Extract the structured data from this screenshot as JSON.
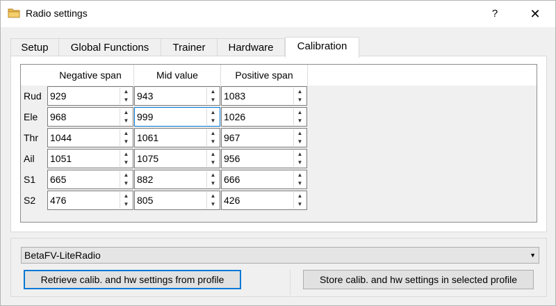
{
  "window": {
    "title": "Radio settings",
    "help_label": "?",
    "close_label": "✕"
  },
  "tabs": [
    {
      "label": "Setup",
      "active": false
    },
    {
      "label": "Global Functions",
      "active": false
    },
    {
      "label": "Trainer",
      "active": false
    },
    {
      "label": "Hardware",
      "active": false
    },
    {
      "label": "Calibration",
      "active": true
    }
  ],
  "calibration": {
    "columns": [
      "Negative span",
      "Mid value",
      "Positive span"
    ],
    "rows": [
      {
        "label": "Rud",
        "values": [
          "929",
          "943",
          "1083"
        ]
      },
      {
        "label": "Ele",
        "values": [
          "968",
          "999",
          "1026"
        ]
      },
      {
        "label": "Thr",
        "values": [
          "1044",
          "1061",
          "967"
        ]
      },
      {
        "label": "Ail",
        "values": [
          "1051",
          "1075",
          "956"
        ]
      },
      {
        "label": "S1",
        "values": [
          "665",
          "882",
          "666"
        ]
      },
      {
        "label": "S2",
        "values": [
          "476",
          "805",
          "426"
        ]
      }
    ],
    "focused_cell": {
      "row": 1,
      "col": 1
    }
  },
  "profile": {
    "selected": "BetaFV-LiteRadio",
    "retrieve_label": "Retrieve calib. and hw settings from profile",
    "store_label": "Store calib. and hw settings in selected profile"
  },
  "icons": {
    "title": "folder-icon",
    "spin_up": "▲",
    "spin_down": "▼",
    "combo_arrow": "▼"
  },
  "colors": {
    "accent": "#0078d7",
    "folder": "#e8b84a"
  }
}
